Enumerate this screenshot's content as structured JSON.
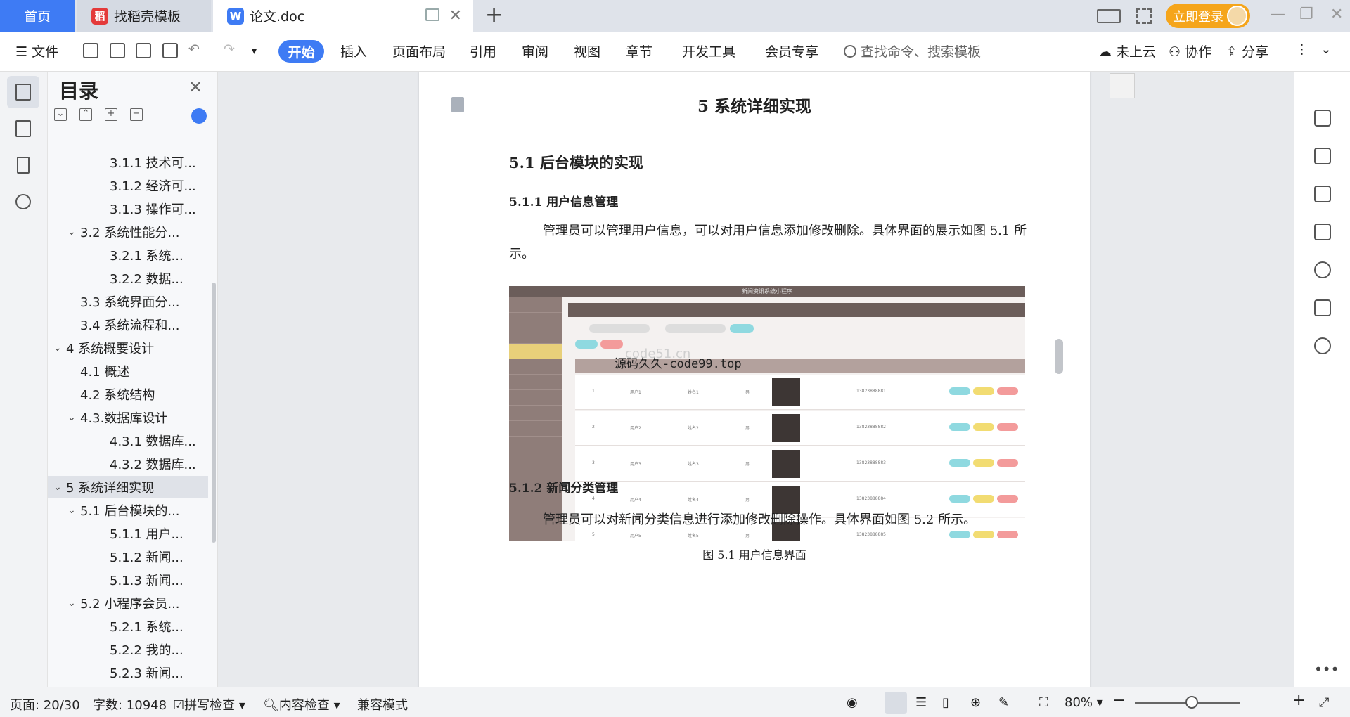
{
  "tabs": {
    "home": "首页",
    "template": "找稻壳模板",
    "doc": "论文.doc",
    "doc_icon": "W",
    "template_icon": "稻"
  },
  "account": {
    "login": "立即登录"
  },
  "ribbon": {
    "file": "文件",
    "tabs": [
      "开始",
      "插入",
      "页面布局",
      "引用",
      "审阅",
      "视图",
      "章节",
      "开发工具",
      "会员专享"
    ],
    "search_placeholder": "查找命令、搜索模板",
    "cloud": "未上云",
    "collab": "协作",
    "share": "分享"
  },
  "toc": {
    "title": "目录",
    "items": [
      {
        "label": "3.1.1 技术可...",
        "level": 3
      },
      {
        "label": "3.1.2 经济可...",
        "level": 3
      },
      {
        "label": "3.1.3 操作可...",
        "level": 3
      },
      {
        "label": "3.2 系统性能分...",
        "level": 2,
        "expand": true
      },
      {
        "label": "3.2.1  系统...",
        "level": 3
      },
      {
        "label": "3.2.2  数据...",
        "level": 3
      },
      {
        "label": "3.3 系统界面分...",
        "level": 2
      },
      {
        "label": "3.4 系统流程和...",
        "level": 2
      },
      {
        "label": "4 系统概要设计",
        "level": 1,
        "expand": true
      },
      {
        "label": "4.1 概述",
        "level": 2
      },
      {
        "label": "4.2 系统结构",
        "level": 2
      },
      {
        "label": "4.3.数据库设计",
        "level": 2,
        "expand": true
      },
      {
        "label": "4.3.1 数据库...",
        "level": 3
      },
      {
        "label": "4.3.2 数据库...",
        "level": 3
      },
      {
        "label": "5 系统详细实现",
        "level": 1,
        "expand": true,
        "selected": true
      },
      {
        "label": "5.1  后台模块的...",
        "level": 2,
        "expand": true
      },
      {
        "label": "5.1.1  用户...",
        "level": 3
      },
      {
        "label": "5.1.2  新闻...",
        "level": 3
      },
      {
        "label": "5.1.3  新闻...",
        "level": 3
      },
      {
        "label": "5.2  小程序会员...",
        "level": 2,
        "expand": true
      },
      {
        "label": "5.2.1  系统...",
        "level": 3
      },
      {
        "label": "5.2.2  我的...",
        "level": 3
      },
      {
        "label": "5.2.3  新闻...",
        "level": 3
      }
    ]
  },
  "document": {
    "chapter": "5 系统详细实现",
    "section": "5.1  后台模块的实现",
    "sub1": "5.1.1  用户信息管理",
    "para1": "管理员可以管理用户信息，可以对用户信息添加修改删除。具体界面的展示如图 5.1 所示。",
    "caption": "图 5.1  用户信息界面",
    "sub2": "5.1.2  新闻分类管理",
    "para2": "管理员可以对新闻分类信息进行添加修改删除操作。具体界面如图 5.2 所示。",
    "screenshot": {
      "header": "新闻资讯系统小程序",
      "watermark_faint": "code51.cn",
      "watermark": "源码久久-code99.top",
      "rows": [
        {
          "no": "1",
          "user": "用户1",
          "name": "姓名1",
          "sex": "男",
          "phone": "13823888881"
        },
        {
          "no": "2",
          "user": "用户2",
          "name": "姓名2",
          "sex": "男",
          "phone": "13823888882"
        },
        {
          "no": "3",
          "user": "用户3",
          "name": "姓名3",
          "sex": "男",
          "phone": "13823888883"
        },
        {
          "no": "4",
          "user": "用户4",
          "name": "姓名4",
          "sex": "男",
          "phone": "13823888884"
        },
        {
          "no": "5",
          "user": "用户5",
          "name": "姓名5",
          "sex": "男",
          "phone": "13823888885"
        }
      ]
    }
  },
  "status": {
    "page": "页面: 20/30",
    "words": "字数: 10948",
    "spell": "拼写检查",
    "content": "内容检查",
    "compat": "兼容模式",
    "zoom": "80%"
  },
  "colors": {
    "accent": "#3e7bf4",
    "login": "#f5a51b"
  }
}
